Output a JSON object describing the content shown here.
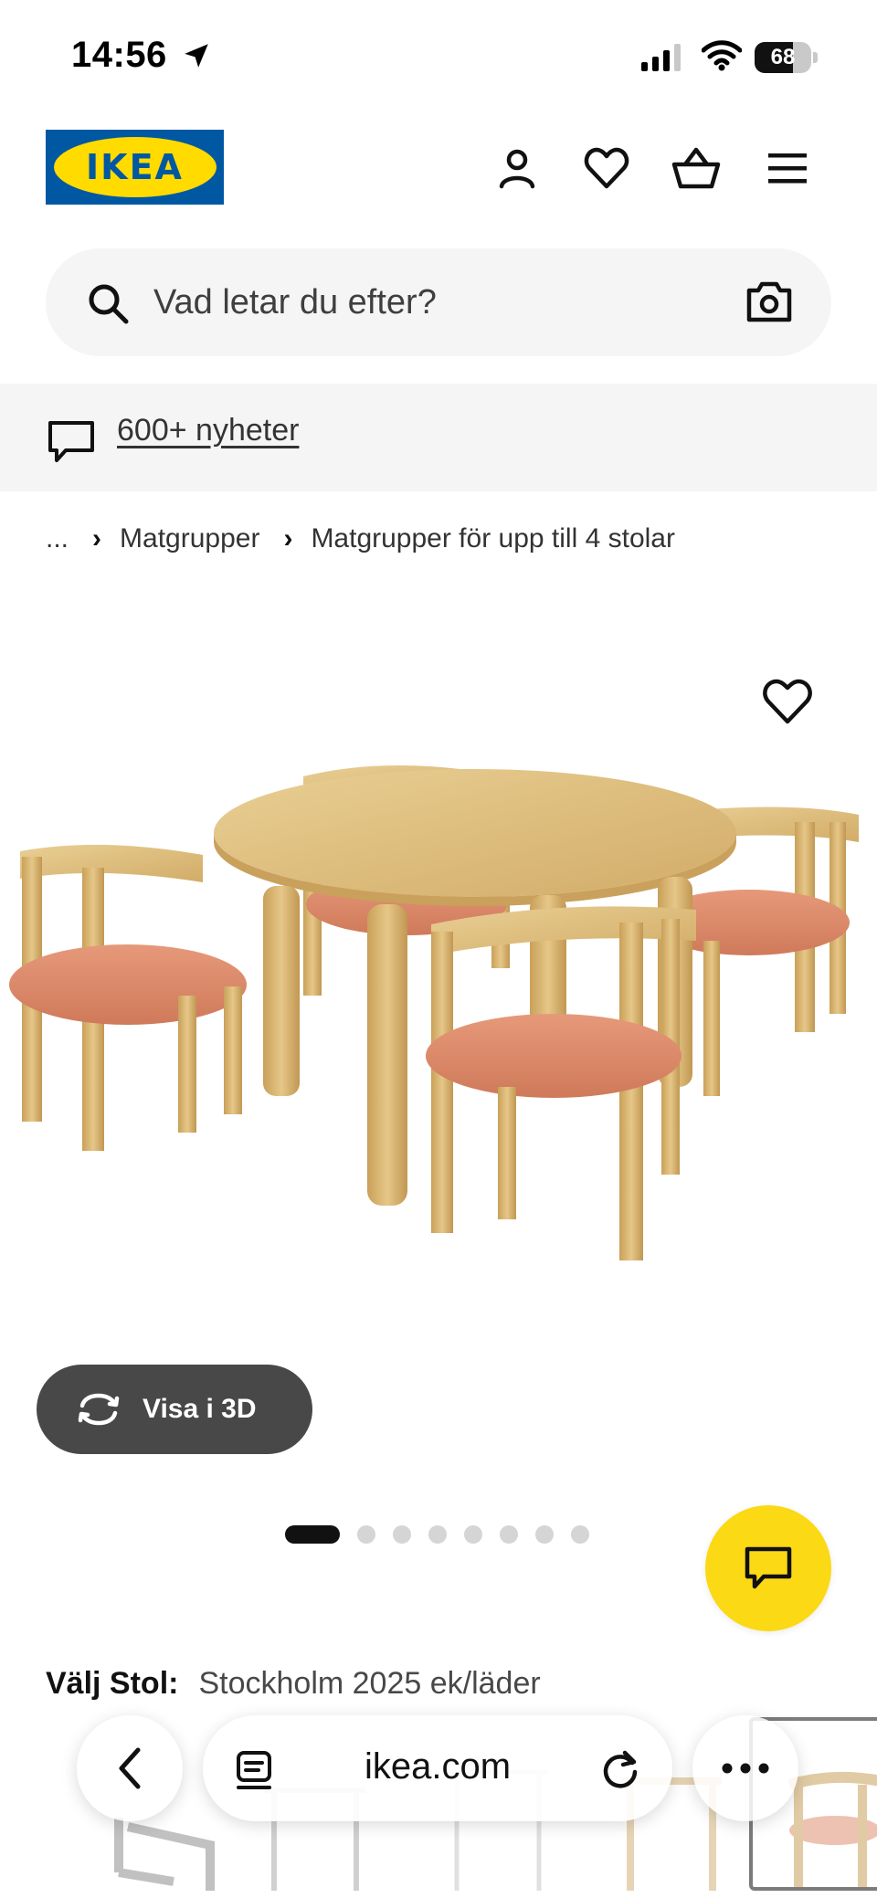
{
  "status_bar": {
    "time": "14:56",
    "battery_level": "68",
    "battery_fraction": 0.68,
    "icons": [
      "location-arrow-icon",
      "cellular-signal-icon",
      "wifi-icon",
      "battery-icon"
    ]
  },
  "header": {
    "logo_text": "IKEA",
    "brand_colors": {
      "blue": "#0058a3",
      "yellow": "#ffdb00"
    },
    "icons": [
      "account-icon",
      "wishlist-heart-icon",
      "shopping-basket-icon",
      "menu-icon"
    ]
  },
  "search": {
    "placeholder": "Vad letar du efter?",
    "icons": [
      "search-icon",
      "camera-icon"
    ]
  },
  "news_banner": {
    "link_text": "600+ nyheter",
    "icon": "speech-bubble-icon"
  },
  "breadcrumb": {
    "ellipsis": "...",
    "items": [
      "Matgrupper",
      "Matgrupper för upp till 4 stolar"
    ]
  },
  "product": {
    "image_alt": "round oak dining table with four oak chairs with orange leather seats",
    "favorite_icon": "heart-icon",
    "view_3d_label": "Visa i 3D",
    "carousel": {
      "total": 8,
      "active_index": 0
    },
    "chat_icon": "chat-icon",
    "chat_color": "#fbd914"
  },
  "options": {
    "label": "Välj Stol:",
    "value": "Stockholm 2025 ek/läder"
  },
  "browser_bar": {
    "url": "ikea.com",
    "icons": [
      "back-chevron-icon",
      "tabs-icon",
      "reload-icon",
      "more-dots-icon"
    ]
  }
}
